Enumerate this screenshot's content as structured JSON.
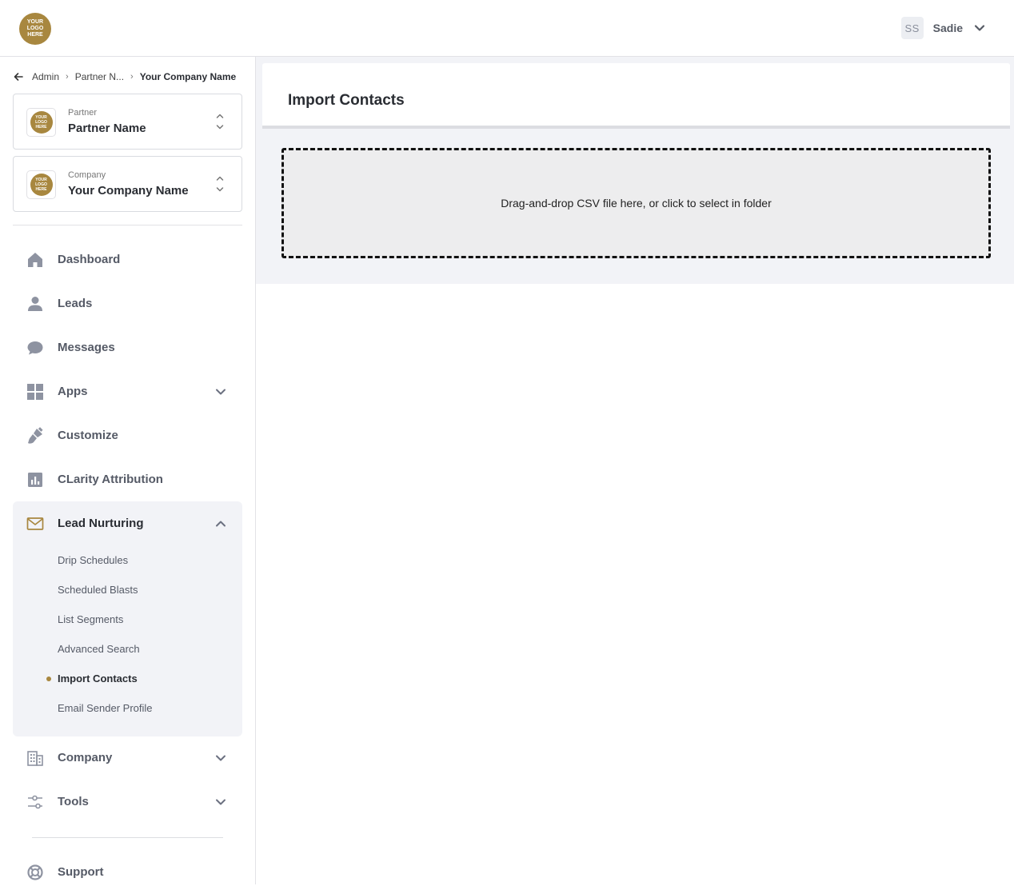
{
  "header": {
    "logo_text": "YOUR\nLOGO\nHERE",
    "user_initials": "SS",
    "user_name": "Sadie"
  },
  "sidebar": {
    "breadcrumb": [
      "Admin",
      "Partner N...",
      "Your Company Name"
    ],
    "partner": {
      "label": "Partner",
      "name": "Partner Name",
      "logo_text": "YOUR\nLOGO\nHERE"
    },
    "company": {
      "label": "Company",
      "name": "Your Company Name",
      "logo_text": "YOUR\nLOGO\nHERE"
    },
    "nav": [
      {
        "label": "Dashboard",
        "icon": "home-icon"
      },
      {
        "label": "Leads",
        "icon": "person-icon"
      },
      {
        "label": "Messages",
        "icon": "chat-bubble-icon"
      },
      {
        "label": "Apps",
        "icon": "grid-icon",
        "expandable": true
      },
      {
        "label": "Customize",
        "icon": "paintbrush-icon"
      },
      {
        "label": "CLarity Attribution",
        "icon": "bar-chart-icon"
      },
      {
        "label": "Lead Nurturing",
        "icon": "envelope-icon",
        "expanded": true
      },
      {
        "label": "Company",
        "icon": "building-icon",
        "expandable": true
      },
      {
        "label": "Tools",
        "icon": "sliders-icon",
        "expandable": true
      },
      {
        "label": "Support",
        "icon": "lifebuoy-icon"
      }
    ],
    "lead_nurturing_items": [
      "Drip Schedules",
      "Scheduled Blasts",
      "List Segments",
      "Advanced Search",
      "Import Contacts",
      "Email Sender Profile"
    ],
    "active_item": "Import Contacts"
  },
  "main": {
    "title": "Import Contacts",
    "dropzone_text": "Drag-and-drop CSV file here, or click to select in folder"
  },
  "colors": {
    "accent": "#a8873f",
    "nav_text": "#555a66",
    "panel_bg": "#f2f3f7"
  }
}
